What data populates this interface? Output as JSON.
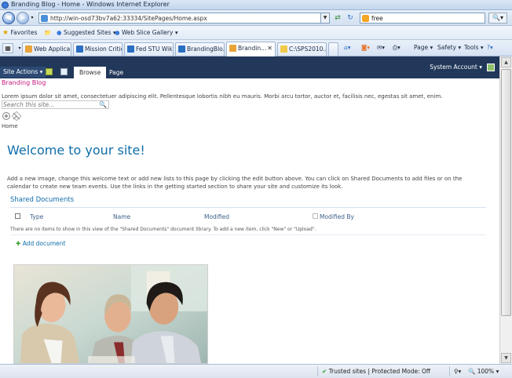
{
  "window": {
    "title": "Branding Blog - Home - Windows Internet Explorer"
  },
  "address": {
    "url": "http://win-osd73bv7a62:33334/SitePages/Home.aspx"
  },
  "search": {
    "value": "free"
  },
  "favorites": {
    "label": "Favorites",
    "items": [
      "Suggested Sites ▾",
      "Web Slice Gallery ▾"
    ]
  },
  "tabs": [
    "Web Applica...",
    "Mission Critic...",
    "Fed STU Wik...",
    "BrandingBlo...",
    "Brandin...",
    "C:\\SPS2010..."
  ],
  "commands": {
    "page": "Page ▾",
    "safety": "Safety ▾",
    "tools": "Tools ▾",
    "help": "?▾"
  },
  "ribbon": {
    "site_actions": "Site Actions ▾",
    "tab_browse": "Browse",
    "tab_page": "Page",
    "account": "System Account ▾"
  },
  "page": {
    "blog_title": "Branding Blog",
    "lorem": "Lorem ipsum dolor sit amet, consectetuer adipiscing elit. Pellentesque lobortis nibh eu mauris. Morbi arcu tortor, auctor et, facilisis nec, egestas sit amet, enim.",
    "search_placeholder": "Search this site...",
    "breadcrumb": "Home",
    "welcome": "Welcome to your site!",
    "intro": "Add a new image, change this welcome text or add new lists to this page by clicking the edit button above. You can click on Shared Documents to add files or on the calendar to create new team events. Use the links in the getting started section to share your site and customize its look.",
    "shared_docs_title": "Shared Documents",
    "columns": [
      "Type",
      "Name",
      "Modified",
      "Modified By"
    ],
    "no_items": "There are no items to show in this view of the \"Shared Documents\" document library. To add a new item, click \"New\" or \"Upload\".",
    "add_document": "Add document"
  },
  "status": {
    "zone": "Trusted sites | Protected Mode: Off",
    "zoom": "100%"
  },
  "colors": {
    "ribbon": "#21385a",
    "link": "#0f6dab",
    "blog_title": "#c2187a"
  }
}
